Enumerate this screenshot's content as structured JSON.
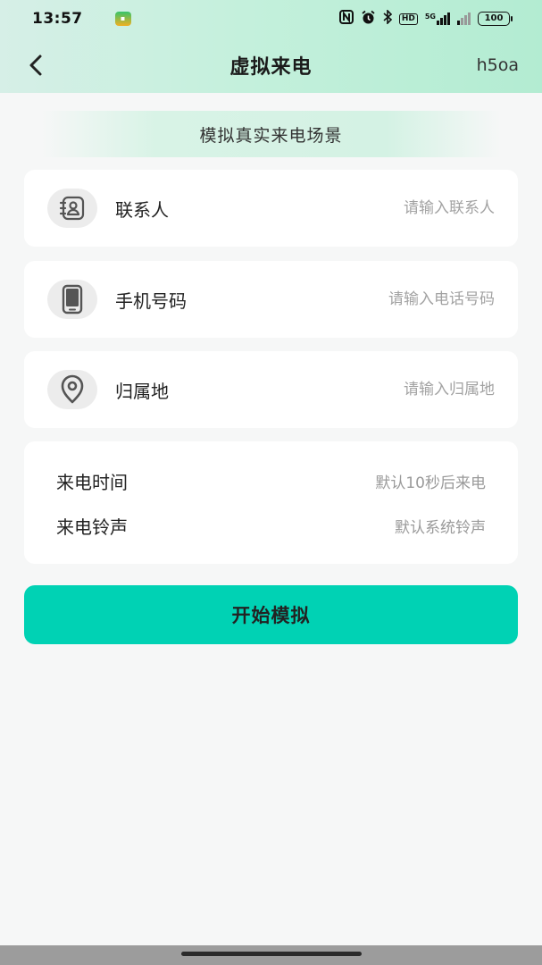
{
  "status_bar": {
    "time": "13:57",
    "battery": "100",
    "network": "5G"
  },
  "nav": {
    "title": "虚拟来电",
    "right_text": "h5oa"
  },
  "banner": {
    "text": "模拟真实来电场景"
  },
  "fields": [
    {
      "label": "联系人",
      "placeholder": "请输入联系人",
      "value": "",
      "icon": "contact-book-icon"
    },
    {
      "label": "手机号码",
      "placeholder": "请输入电话号码",
      "value": "",
      "icon": "phone-icon"
    },
    {
      "label": "归属地",
      "placeholder": "请输入归属地",
      "value": "",
      "icon": "location-pin-icon"
    }
  ],
  "settings": [
    {
      "label": "来电时间",
      "value": "默认10秒后来电"
    },
    {
      "label": "来电铃声",
      "value": "默认系统铃声"
    }
  ],
  "start_button": {
    "label": "开始模拟"
  },
  "colors": {
    "accent": "#00d2b4",
    "header_gradient_start": "#d6efe7",
    "header_gradient_end": "#b3ecd2",
    "background": "#f6f7f7"
  }
}
